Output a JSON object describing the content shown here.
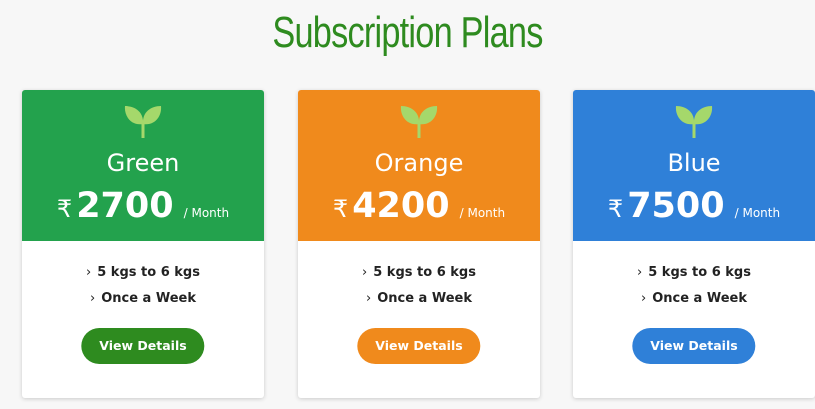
{
  "page": {
    "title": "Subscription Plans"
  },
  "plans": [
    {
      "name": "Green",
      "currency": "₹",
      "price": "2700",
      "period": "/ Month",
      "features": [
        "5 kgs to 6 kgs",
        "Once a Week"
      ],
      "button_label": "View Details",
      "header_color": "#23a24d",
      "button_color": "#2e8b1f"
    },
    {
      "name": "Orange",
      "currency": "₹",
      "price": "4200",
      "period": "/ Month",
      "features": [
        "5 kgs to 6 kgs",
        "Once a Week"
      ],
      "button_label": "View Details",
      "header_color": "#f08a1c",
      "button_color": "#f08a1c"
    },
    {
      "name": "Blue",
      "currency": "₹",
      "price": "7500",
      "period": "/ Month",
      "features": [
        "5 kgs to 6 kgs",
        "Once a Week"
      ],
      "button_label": "View Details",
      "header_color": "#2f80d8",
      "button_color": "#2f80d8"
    }
  ],
  "icons": {
    "plan_icon": "sprout-icon",
    "feature_bullet": "chevron-right-icon"
  },
  "colors": {
    "title": "#2e8b1f",
    "leaf": "#a5d86b"
  }
}
